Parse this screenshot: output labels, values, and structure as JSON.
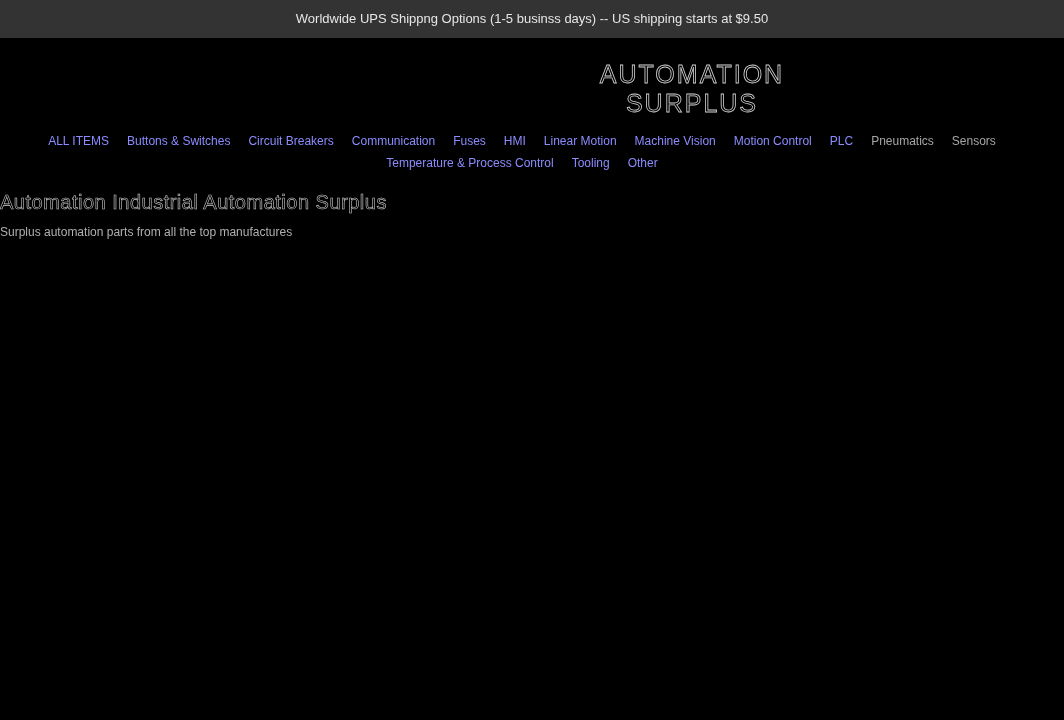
{
  "announcement_bar": {
    "text": "Worldwide UPS Shippng Options (1-5 businss days) -- US shipping starts at $9.50"
  },
  "header": {
    "logo_lines": [
      "AUTOMATION",
      "SURPLUS"
    ]
  },
  "nav": {
    "items": [
      {
        "label": "ALL ITEMS",
        "color": "#8c8cff"
      },
      {
        "label": "Buttons & Switches",
        "color": "#8c8cff"
      },
      {
        "label": "Circuit Breakers",
        "color": "#8c8cff"
      },
      {
        "label": "Communication",
        "color": "#8c8cff"
      },
      {
        "label": "Fuses",
        "color": "#8c8cff"
      },
      {
        "label": "HMI",
        "color": "#8c8cff"
      },
      {
        "label": "Linear Motion",
        "color": "#8c8cff"
      },
      {
        "label": "Machine Vision",
        "color": "#8c8cff"
      },
      {
        "label": "Motion Control",
        "color": "#8c8cff"
      },
      {
        "label": "PLC",
        "color": "#8c8cff"
      },
      {
        "label": "Pneumatics",
        "color": "#a6a6a6"
      },
      {
        "label": "Sensors",
        "color": "#a6a6a6"
      },
      {
        "label": "Temperature & Process Control",
        "color": "#8c8cff"
      },
      {
        "label": "Tooling",
        "color": "#8c8cff"
      },
      {
        "label": "Other",
        "color": "#8c8cff"
      }
    ]
  },
  "page": {
    "title": "Automation Industrial Automation Surplus",
    "description": "Surplus automation parts from all the top manufactures"
  }
}
